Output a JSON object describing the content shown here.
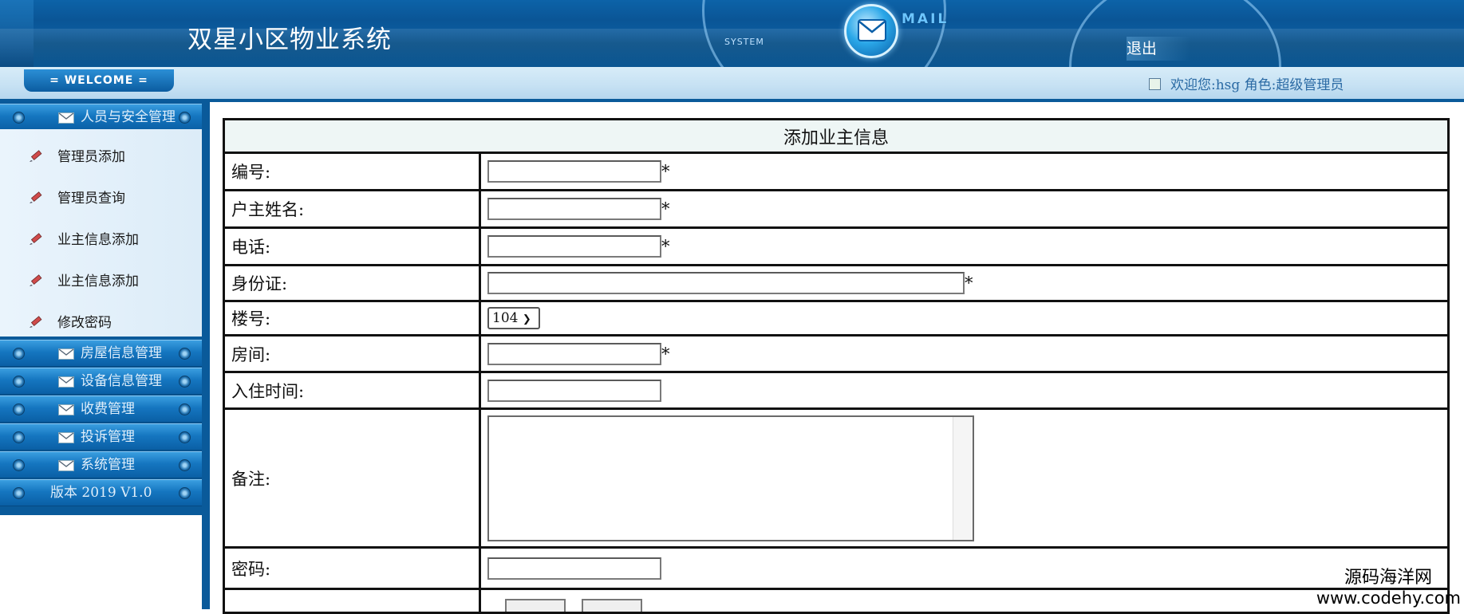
{
  "header": {
    "app_title": "双星小区物业系统",
    "system_word": "SYSTEM",
    "mail_word": "MAIL",
    "logout_label": "退出"
  },
  "welcome_bar": {
    "tab_label": "= WELCOME =",
    "user_info": "欢迎您:hsg 角色:超级管理员"
  },
  "sidebar": {
    "sections": [
      {
        "label": "人员与安全管理",
        "expanded": true
      },
      {
        "label": "房屋信息管理"
      },
      {
        "label": "设备信息管理"
      },
      {
        "label": "收费管理"
      },
      {
        "label": "投诉管理"
      },
      {
        "label": "系统管理"
      }
    ],
    "items": [
      {
        "label": "管理员添加"
      },
      {
        "label": "管理员查询"
      },
      {
        "label": "业主信息添加"
      },
      {
        "label": "业主信息添加"
      },
      {
        "label": "修改密码"
      }
    ],
    "version": "版本 2019 V1.0"
  },
  "form": {
    "title": "添加业主信息",
    "required_mark": "*",
    "fields": {
      "id_label": "编号:",
      "owner_name_label": "户主姓名:",
      "phone_label": "电话:",
      "id_card_label": "身份证:",
      "building_label": "楼号:",
      "building_value": "104",
      "room_label": "房间:",
      "move_in_label": "入住时间:",
      "remarks_label": "备注:",
      "password_label": "密码:"
    }
  },
  "watermark": {
    "line1": "源码海洋网",
    "line2": "www.codehy.com"
  },
  "colors": {
    "header_blue": "#0a5a9a",
    "sidebar_blue": "#1576c0",
    "welcome_text": "#2a6aa4"
  }
}
